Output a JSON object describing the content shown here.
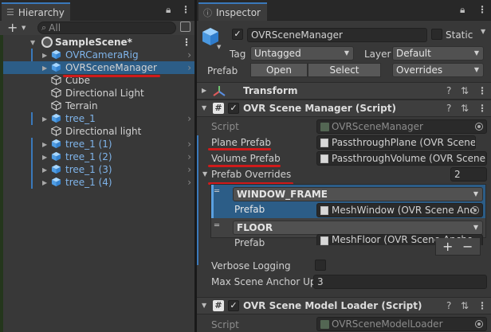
{
  "hierarchy": {
    "tab_label": "Hierarchy",
    "search_placeholder": "All",
    "scene_name": "SampleScene*",
    "items": [
      {
        "label": "OVRCameraRig",
        "blue": true
      },
      {
        "label": "OVRSceneManager",
        "blue": false
      },
      {
        "label": "Cube",
        "blue": false
      },
      {
        "label": "Directional Light",
        "blue": false
      },
      {
        "label": "Terrain",
        "blue": false
      },
      {
        "label": "tree_1",
        "blue": true
      },
      {
        "label": "Directional light",
        "blue": false
      },
      {
        "label": "tree_1 (1)",
        "blue": true
      },
      {
        "label": "tree_1 (2)",
        "blue": true
      },
      {
        "label": "tree_1 (3)",
        "blue": true
      },
      {
        "label": "tree_1 (4)",
        "blue": true
      }
    ]
  },
  "inspector": {
    "tab_label": "Inspector",
    "object_name": "OVRSceneManager",
    "static_label": "Static",
    "tag_label": "Tag",
    "tag_value": "Untagged",
    "layer_label": "Layer",
    "layer_value": "Default",
    "prefab_label": "Prefab",
    "open_label": "Open",
    "select_label": "Select",
    "overrides_label": "Overrides",
    "transform": {
      "title": "Transform"
    },
    "scene_manager": {
      "title": "OVR Scene Manager (Script)",
      "script_label": "Script",
      "script_value": "OVRSceneManager",
      "plane_prefab_label": "Plane Prefab",
      "plane_prefab_value": "PassthroughPlane (OVR Scene A",
      "volume_prefab_label": "Volume Prefab",
      "volume_prefab_value": "PassthroughVolume (OVR Scene",
      "overrides_label": "Prefab Overrides",
      "overrides_count": "2",
      "overrides": [
        {
          "type": "WINDOW_FRAME",
          "prefab_label": "Prefab",
          "prefab_value": "MeshWindow (OVR Scene Anc"
        },
        {
          "type": "FLOOR",
          "prefab_label": "Prefab",
          "prefab_value": "MeshFloor (OVR Scene Ancho"
        }
      ],
      "plus": "+",
      "minus": "−",
      "verbose_label": "Verbose Logging",
      "max_anchor_label": "Max Scene Anchor Upc",
      "max_anchor_value": "3"
    },
    "model_loader": {
      "title": "OVR Scene Model Loader (Script)",
      "script_label": "Script",
      "script_value": "OVRSceneModelLoader"
    }
  },
  "colors": {
    "selection": "#2c5d87",
    "accent": "#3a79bb",
    "annotation": "#d11a1a",
    "prefab_blue": "#7fb4ea"
  }
}
